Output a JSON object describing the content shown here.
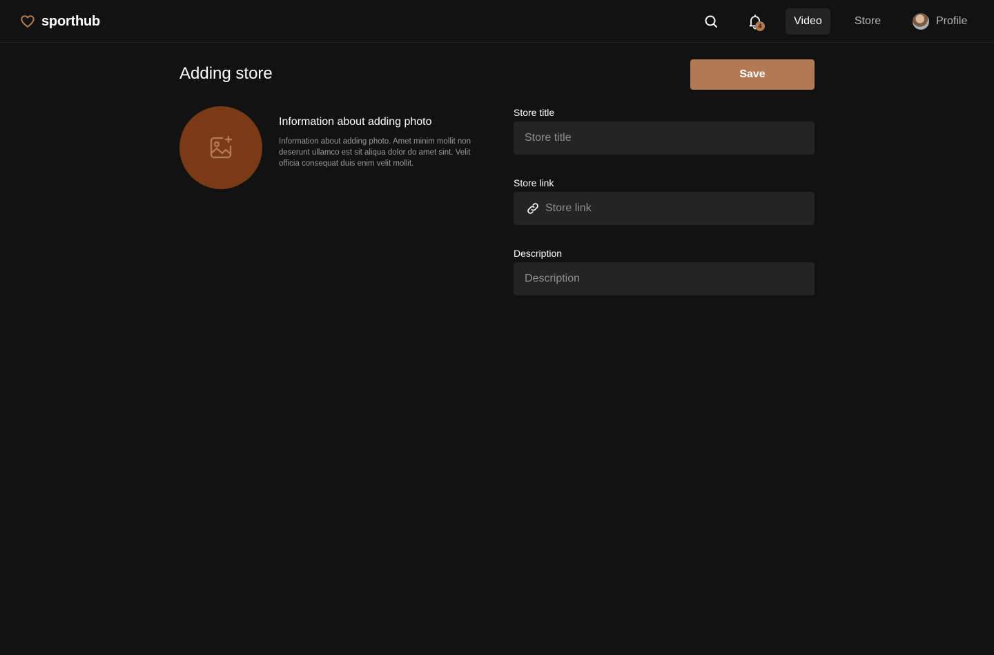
{
  "app": {
    "name": "sporthub",
    "accent_color": "#b27a52"
  },
  "header": {
    "notification_count": "4",
    "nav": {
      "video": "Video",
      "store": "Store",
      "profile": "Profile"
    },
    "active_tab": "Video"
  },
  "page": {
    "title": "Adding store",
    "save_label": "Save"
  },
  "photo": {
    "icon": "image-add-icon",
    "info_title": "Information about adding photo",
    "info_text": "Information about adding photo. Amet minim mollit non deserunt ullamco est sit aliqua dolor do amet sint. Velit officia consequat duis enim velit mollit."
  },
  "form": {
    "store_title": {
      "label": "Store title",
      "placeholder": "Store title",
      "value": ""
    },
    "store_link": {
      "label": "Store link",
      "placeholder": "Store link",
      "value": "",
      "icon": "link-icon"
    },
    "description": {
      "label": "Description",
      "placeholder": "Description",
      "value": ""
    }
  }
}
